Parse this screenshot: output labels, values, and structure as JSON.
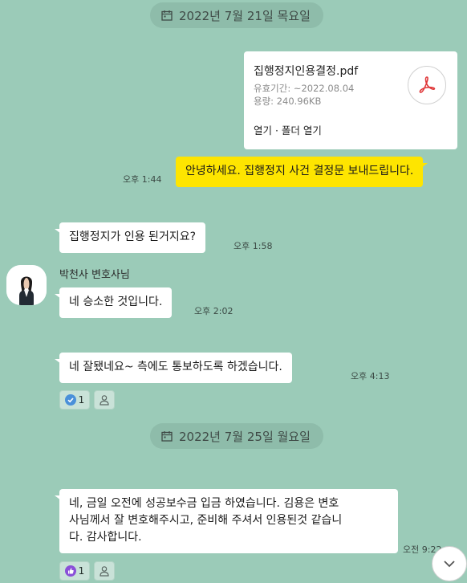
{
  "dates": [
    {
      "label": "2022년 7월 21일 목요일"
    },
    {
      "label": "2022년 7월 25일 월요일"
    }
  ],
  "file": {
    "name": "집행정지인용결정.pdf",
    "expiry": "유효기간: ~2022.08.04",
    "size": "용량: 240.96KB",
    "actions": "열기 · 폴더 열기"
  },
  "messages": [
    {
      "text": "안녕하세요. 집행정지 사건 결정문 보내드립니다.",
      "time": "오후 1:44"
    },
    {
      "text": "집행정지가 인용 된거지요?",
      "time": "오후 1:58"
    },
    {
      "text": "네 승소한 것입니다.",
      "time": "오후 2:02"
    },
    {
      "text": "네 잘됐네요~       측에도 통보하도록 하겠습니다.",
      "time": "오후 4:13"
    },
    {
      "line1": "네, 금일 오전에 성공보수금 입금 하였습니다. 김용은 변호",
      "line2": "사님께서 잘 변호해주시고, 준비해 주셔서 인용된것 같습니",
      "line3": "다. 감사합니다.",
      "time": "오전 9:22"
    }
  ],
  "sender": {
    "name": "박천사 변호사님"
  },
  "reactions": [
    {
      "count": "1",
      "icon": "check-icon"
    },
    {
      "count": "1",
      "icon": "thumbs-up-icon"
    }
  ],
  "colors": {
    "background": "#9bcbb8",
    "my_bubble": "#fee500",
    "their_bubble": "#ffffff",
    "check": "#4a90d9",
    "thumb": "#8a4fd8"
  }
}
